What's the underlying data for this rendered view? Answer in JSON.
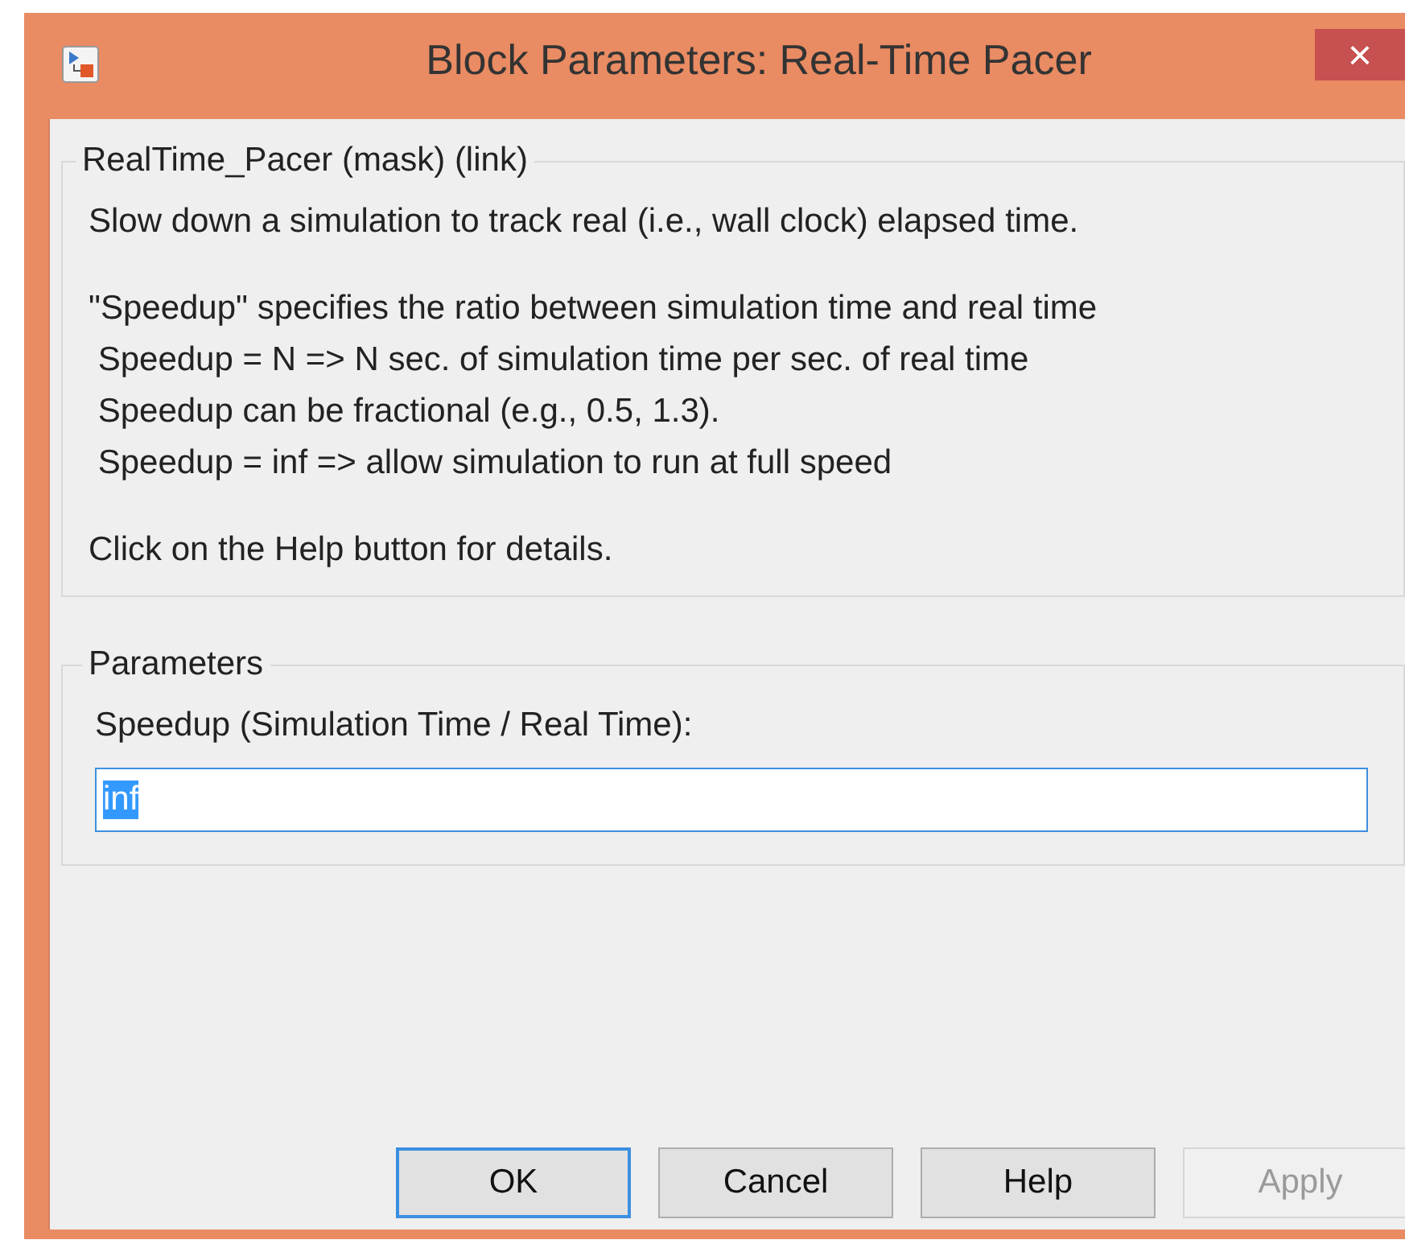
{
  "window": {
    "title": "Block Parameters: Real-Time Pacer",
    "close": "×"
  },
  "description": {
    "legend": "RealTime_Pacer (mask) (link)",
    "paragraphs": [
      [
        "Slow down a simulation to track real (i.e., wall clock) elapsed time."
      ],
      [
        "\"Speedup\" specifies the ratio between simulation time and real time",
        " Speedup = N => N sec. of simulation time per sec. of real time",
        " Speedup can be fractional (e.g., 0.5, 1.3).",
        " Speedup = inf => allow simulation to run at full speed"
      ],
      [
        "Click on the Help button for details."
      ]
    ]
  },
  "parameters": {
    "legend": "Parameters",
    "label": "Speedup (Simulation Time / Real Time):",
    "value": "inf",
    "value_selected": true
  },
  "buttons": [
    {
      "label": "OK",
      "default": true,
      "disabled": false
    },
    {
      "label": "Cancel",
      "default": false,
      "disabled": false
    },
    {
      "label": "Help",
      "default": false,
      "disabled": false
    },
    {
      "label": "Apply",
      "default": false,
      "disabled": true
    }
  ]
}
